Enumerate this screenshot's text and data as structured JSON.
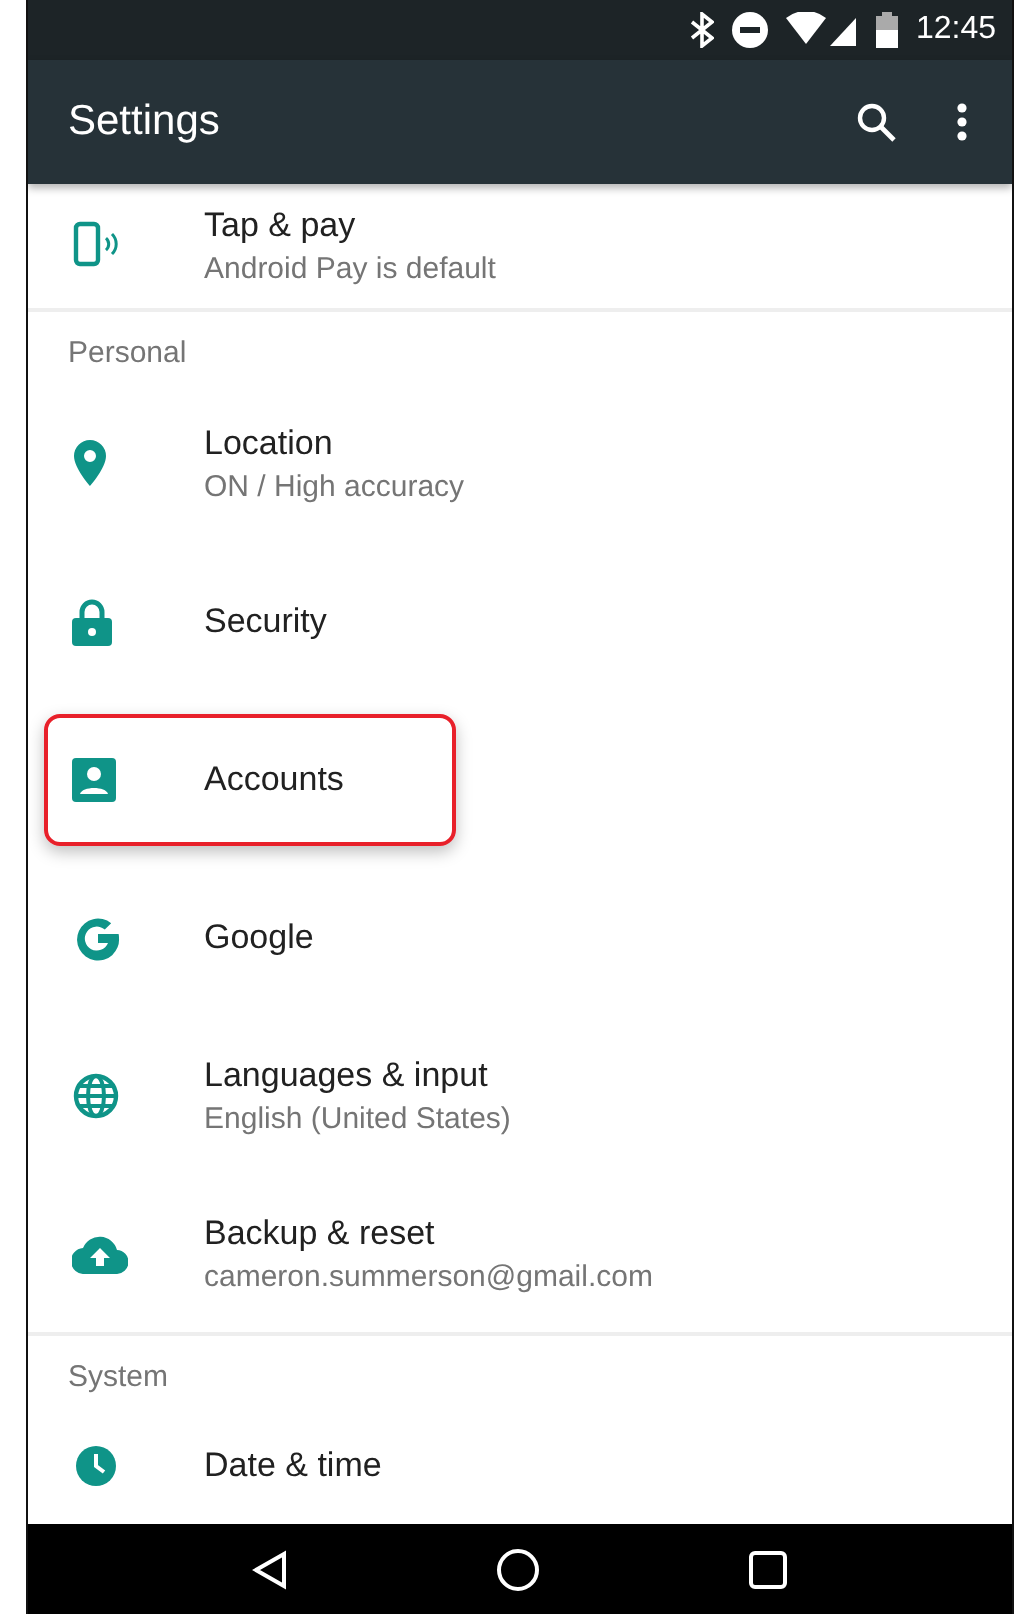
{
  "status_bar": {
    "time": "12:45"
  },
  "app_bar": {
    "title": "Settings"
  },
  "sections": [
    {
      "items": [
        {
          "title": "Tap & pay",
          "subtitle": "Android Pay is default",
          "highlighted": false
        }
      ]
    },
    {
      "header": "Personal",
      "items": [
        {
          "title": "Location",
          "subtitle": "ON / High accuracy",
          "highlighted": false
        },
        {
          "title": "Security",
          "highlighted": false
        },
        {
          "title": "Accounts",
          "highlighted": true
        },
        {
          "title": "Google",
          "highlighted": false
        },
        {
          "title": "Languages & input",
          "subtitle": "English (United States)",
          "highlighted": false
        },
        {
          "title": "Backup & reset",
          "subtitle": "cameron.summerson@gmail.com",
          "highlighted": false
        }
      ]
    },
    {
      "header": "System",
      "items": [
        {
          "title": "Date & time",
          "highlighted": false
        }
      ]
    }
  ]
}
